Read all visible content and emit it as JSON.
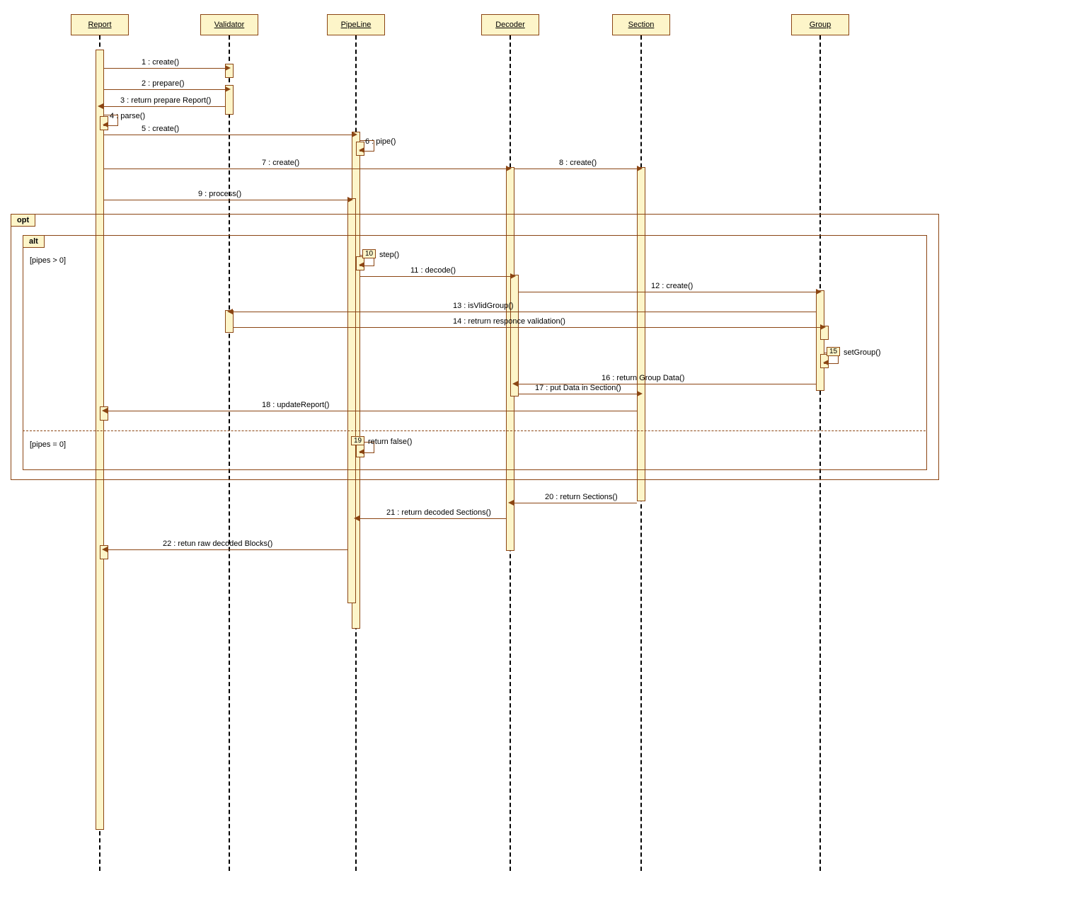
{
  "lifelines": [
    "Report",
    "Validator",
    "PipeLine",
    "Decoder",
    "Section",
    "Group"
  ],
  "messages": {
    "m1": "1 : create()",
    "m2": "2 : prepare()",
    "m3": "3 : return prepare Report()",
    "m4": "4 : parse()",
    "m5": "5 : create()",
    "m6": "6 : pipe()",
    "m7": "7 : create()",
    "m8": "8 : create()",
    "m9": "9 : process()",
    "m10n": "10",
    "m10": "step()",
    "m11": "11 : decode()",
    "m12": "12 : create()",
    "m13": "13 : isVlidGroup()",
    "m14": "14 : retrurn responce validation()",
    "m15n": "15",
    "m15": "setGroup()",
    "m16": "16 : return Group Data()",
    "m17": "17 : put Data in Section()",
    "m18": "18 : updateReport()",
    "m19n": "19",
    "m19": "return false()",
    "m20": "20 : return Sections()",
    "m21": "21 : return decoded Sections()",
    "m22": "22 : retun raw decoded Blocks()"
  },
  "frags": {
    "opt": "opt",
    "alt": "alt"
  },
  "guards": {
    "g1": "[pipes > 0]",
    "g2": "[pipes = 0]"
  }
}
